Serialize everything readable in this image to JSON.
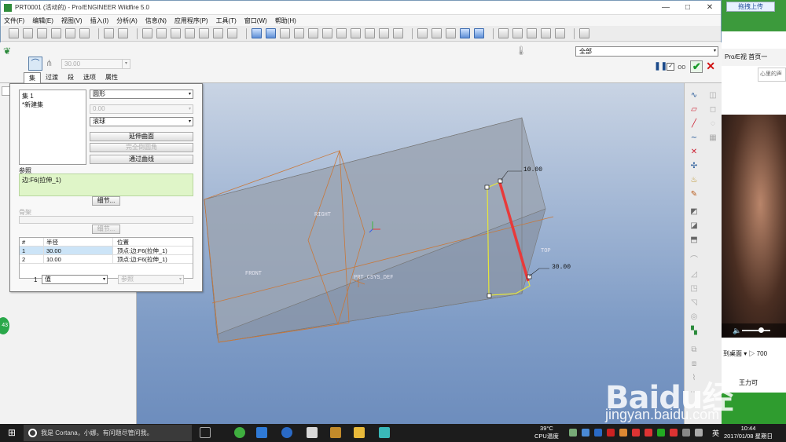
{
  "window": {
    "title": "PRT0001 (活动的) - Pro/ENGINEER Wildfire 5.0",
    "minimize": "—",
    "maximize": "□",
    "close": "✕"
  },
  "menu": [
    "文件(F)",
    "编辑(E)",
    "视图(V)",
    "插入(I)",
    "分析(A)",
    "信息(N)",
    "应用程序(P)",
    "工具(T)",
    "窗口(W)",
    "帮助(H)"
  ],
  "dashboard": {
    "radius_value": "30.00",
    "filter_value": "全部",
    "tabs": [
      "集",
      "过渡",
      "段",
      "选项",
      "属性"
    ],
    "active_tab": 0
  },
  "panel": {
    "set_items": [
      "集 1",
      "*新建集"
    ],
    "profile": "圆形",
    "profile_value": "0.00",
    "type": "滚球",
    "buttons": [
      "延伸曲面",
      "完全倒圆角",
      "通过曲线"
    ],
    "refs_label": "参照",
    "refs_value": "边:F6(拉伸_1)",
    "details_label": "细节...",
    "bone_label": "骨架",
    "bone_details": "细节...",
    "table": {
      "headers": [
        "#",
        "半径",
        "位置"
      ],
      "rows": [
        {
          "n": "1",
          "radius": "30.00",
          "loc": "顶点:边:F6(拉伸_1)"
        },
        {
          "n": "2",
          "radius": "10.00",
          "loc": "顶点:边:F6(拉伸_1)"
        }
      ]
    },
    "bottom_num": "1",
    "bottom_value": "值",
    "bottom_ref": "参照"
  },
  "graphics": {
    "labels": {
      "right": "RIGHT",
      "front": "FRONT",
      "top": "TOP",
      "csys": "PRT_CSYS_DEF",
      "dim1": "10.00",
      "dim2": "30.00"
    }
  },
  "side": {
    "upload": "拖拽上传",
    "bar2": "Pro/E视  首页一",
    "search_hint": "心里的声",
    "bar3": "到桌面 ▾    ▷ 700",
    "bar4": "王力可",
    "badge": "43"
  },
  "taskbar": {
    "cortana": "我是 Cortana，小娜。有问题尽管问我。",
    "temp": "39°C",
    "cpu": "CPU温度",
    "ime": "英",
    "time": "10:44",
    "date": "2017/01/08 星期日"
  },
  "watermark": {
    "brand": "Baidu经验",
    "url": "jingyan.baidu.com"
  }
}
